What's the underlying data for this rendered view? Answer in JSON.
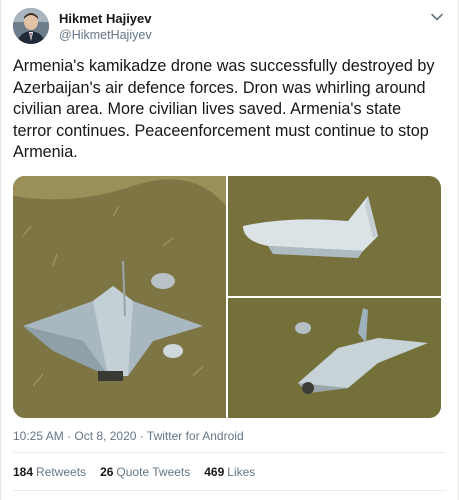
{
  "user": {
    "display_name": "Hikmet Hajiyev",
    "handle": "@HikmetHajiyev"
  },
  "tweet": {
    "text": "Armenia's kamikadze drone was successfully destroyed by Azerbaijan's air defence forces. Dron was whirling around civilian area. More civilian lives saved. Armenia's state terror continues. Peaceenforcement must continue to stop Armenia."
  },
  "meta": {
    "time": "10:25 AM",
    "separator1": "·",
    "date": "Oct 8, 2020",
    "separator2": "·",
    "source": "Twitter for Android"
  },
  "stats": {
    "retweets_count": "184",
    "retweets_label": "Retweets",
    "quotes_count": "26",
    "quotes_label": "Quote Tweets",
    "likes_count": "469",
    "likes_label": "Likes"
  },
  "icons": {
    "menu": "chevron-down-icon"
  },
  "colors": {
    "text": "#14171a",
    "secondary": "#657786",
    "divider": "#e6ecf0"
  }
}
